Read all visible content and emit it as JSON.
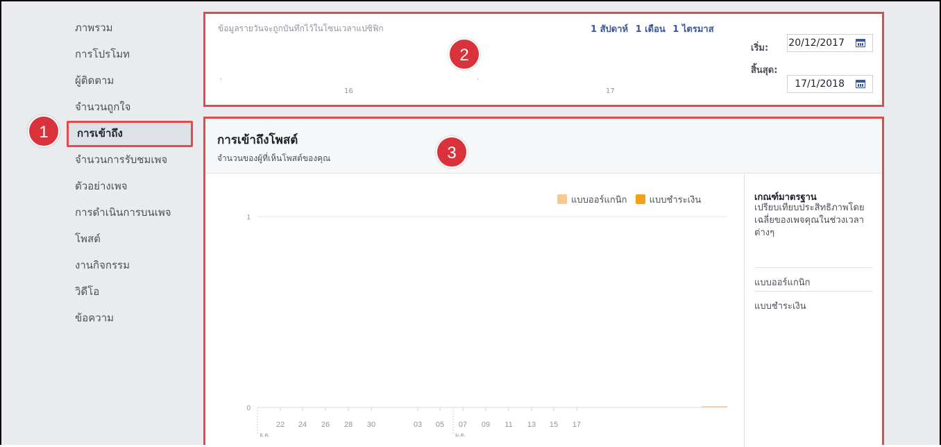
{
  "sidebar": {
    "items": [
      {
        "label": "ภาพรวม"
      },
      {
        "label": "การโปรโมท"
      },
      {
        "label": "ผู้ติดตาม"
      },
      {
        "label": "จำนวนถูกใจ"
      },
      {
        "label": "การเข้าถึง",
        "active": true
      },
      {
        "label": "จำนวนการรับชมเพจ"
      },
      {
        "label": "ตัวอย่างเพจ"
      },
      {
        "label": "การดำเนินการบนเพจ"
      },
      {
        "label": "โพสต์"
      },
      {
        "label": "งานกิจกรรม"
      },
      {
        "label": "วิดีโอ"
      },
      {
        "label": "ข้อความ"
      }
    ]
  },
  "badges": {
    "one": "1",
    "two": "2",
    "three": "3"
  },
  "timeline": {
    "note": "ข้อมูลรายวันจะถูกบันทึกไว้ในโซนเวลาแปซิฟิก",
    "ranges": [
      "1 สัปดาห์",
      "1 เดือน",
      "1 ไตรมาส"
    ],
    "ticks": [
      "16",
      "17"
    ],
    "start_label": "เริ่ม:",
    "start_value": "20/12/2017",
    "end_label": "สิ้นสุด:",
    "end_value": "17/1/2018"
  },
  "reach": {
    "title": "การเข้าถึงโพสต์",
    "subtitle": "จำนวนของผู้ที่เห็นโพสต์ของคุณ",
    "legend": [
      {
        "label": "แบบออร์แกนิก",
        "color": "#f7c98f"
      },
      {
        "label": "แบบชำระเงิน",
        "color": "#f5a01a"
      }
    ],
    "benchmark": {
      "title": "เกณฑ์มาตรฐาน",
      "desc": "เปรียบเทียบประสิทธิภาพโดยเฉลี่ยของเพจคุณในช่วงเวลาต่างๆ",
      "rows": [
        "แบบออร์แกนิก",
        "แบบชำระเงิน"
      ]
    }
  },
  "chart_data": {
    "type": "line",
    "x": [
      "22",
      "24",
      "26",
      "28",
      "30",
      "03",
      "05",
      "07",
      "09",
      "11",
      "13",
      "15",
      "17"
    ],
    "month_labels": [
      "ธ.ค.",
      "ม.ค."
    ],
    "y_ticks": [
      "1",
      "0"
    ],
    "ylim": [
      0,
      1
    ],
    "series": [
      {
        "name": "แบบออร์แกนิก",
        "values": [
          0,
          0,
          0,
          0,
          0,
          0,
          0,
          0,
          0,
          0,
          0,
          0,
          0
        ]
      },
      {
        "name": "แบบชำระเงิน",
        "values": [
          0,
          0,
          0,
          0,
          0,
          0,
          0,
          0,
          0,
          0,
          0,
          0,
          0
        ]
      }
    ]
  }
}
